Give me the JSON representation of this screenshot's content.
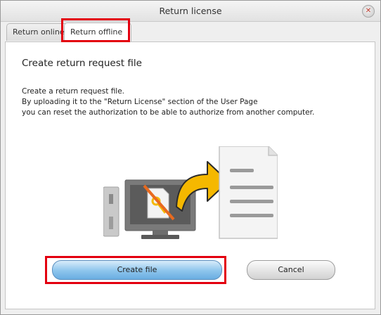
{
  "window": {
    "title": "Return license",
    "close_glyph": "✕"
  },
  "tabs": [
    {
      "label": "Return online",
      "selected": false
    },
    {
      "label": "Return offline",
      "selected": true
    }
  ],
  "panel": {
    "heading": "Create return request file",
    "description": [
      "Create a return request file.",
      "By uploading it to the \"Return License\" section of the User Page",
      "you can reset the authorization to be able to authorize from another computer."
    ]
  },
  "illustration": {
    "icon": "return-license-offline-illustration"
  },
  "buttons": {
    "create": "Create file",
    "cancel": "Cancel"
  },
  "colors": {
    "highlight": "#e3000f",
    "primary_button": "#8cc4ec",
    "arrow": "#f5b800"
  }
}
